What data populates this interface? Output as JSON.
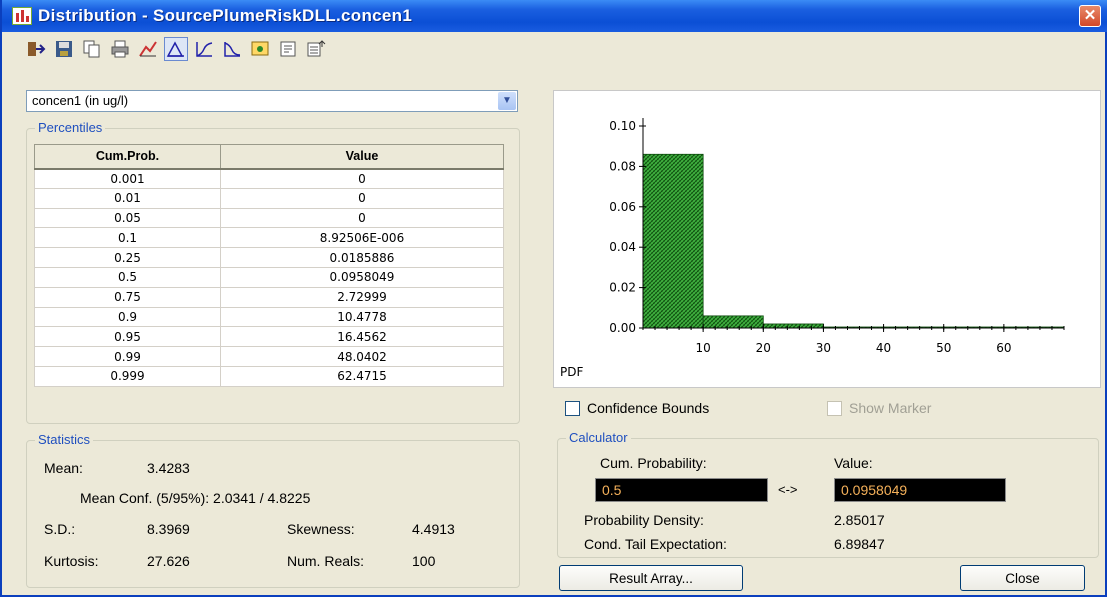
{
  "window": {
    "title": "Distribution - SourcePlumeRiskDLL.concen1",
    "close_glyph": "✕"
  },
  "toolbar": {
    "icons": [
      "export-icon",
      "save-icon",
      "copy-icon",
      "print-icon",
      "chart-settings-icon",
      "pdf-view-icon",
      "cdf-view-icon",
      "ccdf-view-icon",
      "results-table-icon",
      "properties-icon",
      "options-icon"
    ]
  },
  "selector": {
    "value": "concen1 (in ug/l)"
  },
  "percentiles": {
    "label": "Percentiles",
    "headers": [
      "Cum.Prob.",
      "Value"
    ],
    "rows": [
      [
        "0.001",
        "0"
      ],
      [
        "0.01",
        "0"
      ],
      [
        "0.05",
        "0"
      ],
      [
        "0.1",
        "8.92506E-006"
      ],
      [
        "0.25",
        "0.0185886"
      ],
      [
        "0.5",
        "0.0958049"
      ],
      [
        "0.75",
        "2.72999"
      ],
      [
        "0.9",
        "10.4778"
      ],
      [
        "0.95",
        "16.4562"
      ],
      [
        "0.99",
        "48.0402"
      ],
      [
        "0.999",
        "62.4715"
      ]
    ]
  },
  "chart_data": {
    "type": "bar",
    "title": "",
    "xlabel": "",
    "ylabel": "PDF",
    "bins": [
      {
        "x0": 0,
        "x1": 10,
        "value": 0.086
      },
      {
        "x0": 10,
        "x1": 20,
        "value": 0.006
      },
      {
        "x0": 20,
        "x1": 30,
        "value": 0.002
      },
      {
        "x0": 30,
        "x1": 40,
        "value": 0.0005
      },
      {
        "x0": 40,
        "x1": 50,
        "value": 0.0005
      },
      {
        "x0": 50,
        "x1": 60,
        "value": 0.0005
      },
      {
        "x0": 60,
        "x1": 70,
        "value": 0.0005
      }
    ],
    "xlim": [
      0,
      70
    ],
    "ylim": [
      0,
      0.1
    ],
    "xticks": [
      "10",
      "20",
      "30",
      "40",
      "50",
      "60"
    ],
    "yticks": [
      "0.00",
      "0.02",
      "0.04",
      "0.06",
      "0.08",
      "0.10"
    ],
    "bar_color": "#2fa02f"
  },
  "options": {
    "confidence_bounds": "Confidence Bounds",
    "show_marker": "Show Marker"
  },
  "statistics": {
    "label": "Statistics",
    "mean_label": "Mean:",
    "mean_value": "3.4283",
    "mean_conf": "Mean Conf. (5/95%): 2.0341 / 4.8225",
    "sd_label": "S.D.:",
    "sd_value": "8.3969",
    "skew_label": "Skewness:",
    "skew_value": "4.4913",
    "kurt_label": "Kurtosis:",
    "kurt_value": "27.626",
    "reals_label": "Num. Reals:",
    "reals_value": "100"
  },
  "calculator": {
    "label": "Calculator",
    "cum_prob_label": "Cum. Probability:",
    "value_label": "Value:",
    "cum_prob_input": "0.5",
    "arrow": "<->",
    "value_input": "0.0958049",
    "density_label": "Probability Density:",
    "density_value": "2.85017",
    "cte_label": "Cond. Tail Expectation:",
    "cte_value": "6.89847"
  },
  "buttons": {
    "result_array": "Result Array...",
    "close": "Close"
  }
}
